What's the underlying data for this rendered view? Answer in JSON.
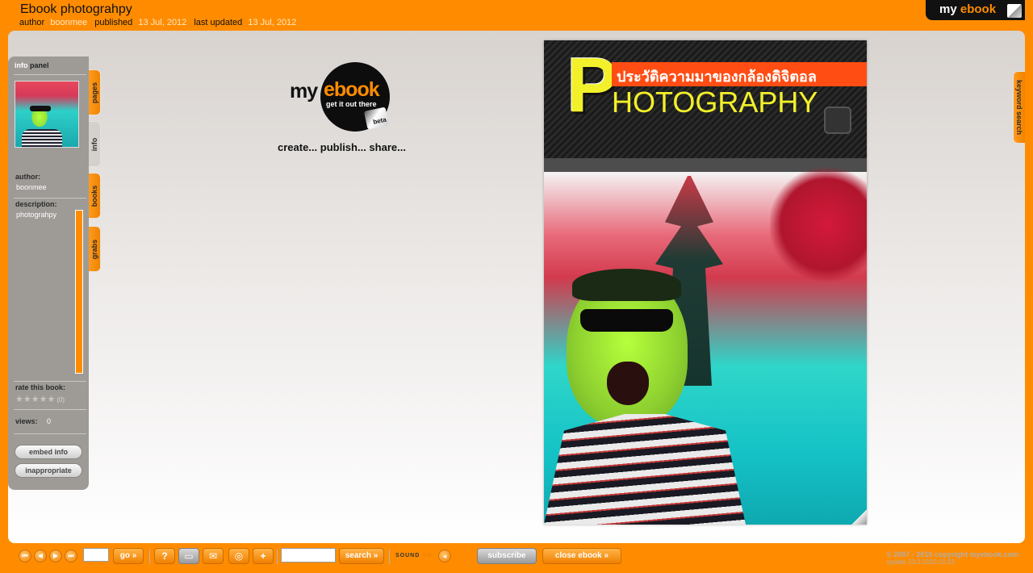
{
  "header": {
    "title": "Ebook photograhpy",
    "author_label": "author",
    "author_value": "boonmee",
    "published_label": "published",
    "published_value": "13 Jul, 2012",
    "updated_label": "last updated",
    "updated_value": "13 Jul, 2012",
    "brand_my": "my",
    "brand_ebook": "ebook"
  },
  "info_panel": {
    "head_info": "info",
    "head_panel": "panel",
    "author_label": "author:",
    "author_value": "boonmee",
    "description_label": "description:",
    "description_value": "photograhpy",
    "rate_label": "rate this book:",
    "stars_display": "★★★★★",
    "rating_count": "(0)",
    "rating": 0,
    "views_label": "views:",
    "views_value": "0",
    "embed_button": "embed info",
    "inappropriate_button": "inappropriate"
  },
  "side_tabs": [
    {
      "label": "pages"
    },
    {
      "label": "info"
    },
    {
      "label": "books"
    },
    {
      "label": "grabs"
    }
  ],
  "right_tab": {
    "label": "keyword search"
  },
  "logo": {
    "my": "my",
    "ebook": "ebook",
    "tagline": "get it out there",
    "beta": "beta",
    "slogan": "create... publish... share..."
  },
  "cover": {
    "big_letter": "P",
    "thai_title": "ประวัติความมาของกล้องดิจิตอล",
    "word": "HOTOGRAPHY"
  },
  "toolbar": {
    "first_icon": "⏮",
    "prev_icon": "◀",
    "next_icon": "▶",
    "last_icon": "⏭",
    "page_value": "",
    "go_label": "go »",
    "search_value": "",
    "search_label": "search »",
    "sound_label": "SOUND",
    "sound_state": "ON",
    "subscribe_label": "subscribe",
    "close_label": "close ebook »",
    "copyright": "© 2007 - 2010 copyright myebook.com",
    "update_text": "update 22:3:2010:10:33"
  },
  "colors": {
    "brand_orange": "#ff8c00",
    "panel_grey": "#9e9b97",
    "cover_yellow": "#f2f02a",
    "cover_red": "#ff4d14"
  }
}
